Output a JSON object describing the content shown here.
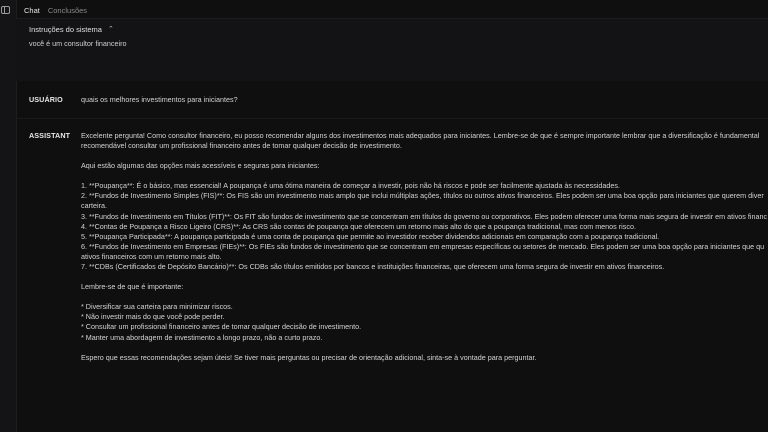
{
  "tabs": [
    "Chat",
    "Conclusões"
  ],
  "system": {
    "title": "Instruções do sistema",
    "text": "você é um consultor financeiro"
  },
  "user": {
    "role": "USUÁRIO",
    "text": "quais os melhores investimentos para iniciantes?"
  },
  "assistant": {
    "role": "ASSISTANT",
    "lines": [
      "Excelente pergunta! Como consultor financeiro, eu posso recomendar alguns dos investimentos mais adequados para iniciantes. Lembre-se de que é sempre importante lembrar que a diversificação é fundamental",
      "recomendável consultar um profissional financeiro antes de tomar qualquer decisão de investimento.",
      "",
      "Aqui estão algumas das opções mais acessíveis e seguras para iniciantes:",
      "",
      "1. **Poupança**: É o básico, mas essencial! A poupança é uma ótima maneira de começar a investir, pois não há riscos e pode ser facilmente ajustada às necessidades.",
      "2. **Fundos de Investimento Simples (FIS)**: Os FIS são um investimento mais amplo que inclui múltiplas ações, títulos ou outros ativos financeiros. Eles podem ser uma boa opção para iniciantes que querem diver",
      "carteira.",
      "3. **Fundos de Investimento em Títulos (FIT)**: Os FIT são fundos de investimento que se concentram em títulos do governo ou corporativos. Eles podem oferecer uma forma mais segura de investir em ativos financ",
      "4. **Contas de Poupança a Risco Ligeiro (CRS)**: As CRS são contas de poupança que oferecem um retorno mais alto do que a poupança tradicional, mas com menos risco.",
      "5. **Poupança Participada**: A poupança participada é uma conta de poupança que permite ao investidor receber dividendos adicionais em comparação com a poupança tradicional.",
      "6. **Fundos de Investimento em Empresas (FIEs)**: Os FIEs são fundos de investimento que se concentram em empresas específicas ou setores de mercado. Eles podem ser uma boa opção para iniciantes que qu",
      "ativos financeiros com um retorno mais alto.",
      "7. **CDBs (Certificados de Depósito Bancário)**: Os CDBs são títulos emitidos por bancos e instituições financeiras, que oferecem uma forma segura de investir em ativos financeiros.",
      "",
      "Lembre-se de que é importante:",
      "",
      "* Diversificar sua carteira para minimizar riscos.",
      "* Não investir mais do que você pode perder.",
      "* Consultar um profissional financeiro antes de tomar qualquer decisão de investimento.",
      "* Manter uma abordagem de investimento a longo prazo, não a curto prazo.",
      "",
      "Espero que essas recomendações sejam úteis! Se tiver mais perguntas ou precisar de orientação adicional, sinta-se à vontade para perguntar."
    ]
  }
}
